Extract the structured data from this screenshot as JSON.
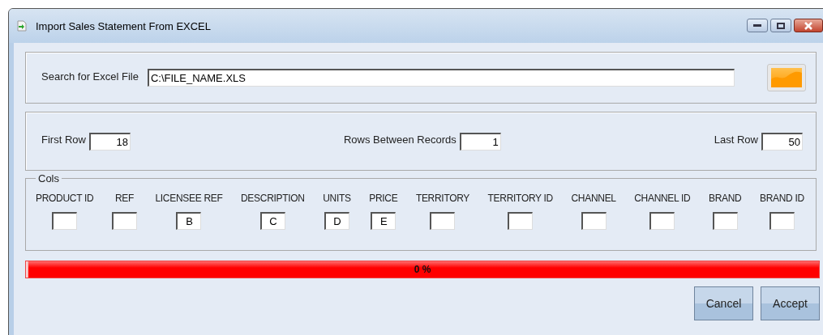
{
  "window": {
    "title": "Import Sales Statement From EXCEL"
  },
  "search": {
    "label": "Search for Excel File",
    "value": "C:\\FILE_NAME.XLS"
  },
  "rows": [
    {
      "label": "First Row",
      "value": "18"
    },
    {
      "label": "Rows Between Records",
      "value": "1"
    },
    {
      "label": "Last Row",
      "value": "50"
    }
  ],
  "cols": {
    "title": "Cols",
    "columns": [
      {
        "label": "PRODUCT ID"
      },
      {
        "label": "REF"
      },
      {
        "label": "LICENSEE REF",
        "value": "B"
      },
      {
        "label": "DESCRIPTION",
        "value": "C"
      },
      {
        "label": "UNITS",
        "value": "D"
      },
      {
        "label": "PRICE",
        "value": "E"
      },
      {
        "label": "TERRITORY"
      },
      {
        "label": "TERRITORY ID"
      },
      {
        "label": "CHANNEL"
      },
      {
        "label": "CHANNEL ID"
      },
      {
        "label": "BRAND"
      },
      {
        "label": "BRAND ID"
      }
    ]
  },
  "progress": {
    "level": 0,
    "reading": "0 %"
  },
  "buttons": [
    "Cancel",
    "Accept"
  ]
}
